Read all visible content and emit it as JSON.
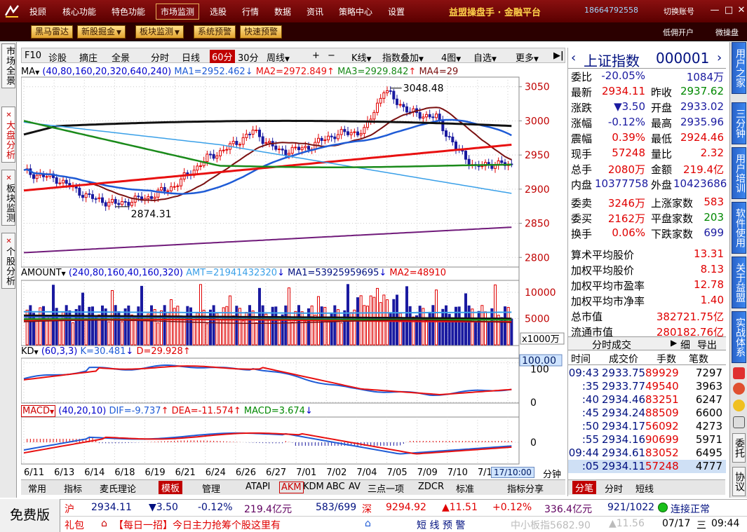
{
  "menu": {
    "items": [
      "投顾",
      "核心功能",
      "特色功能",
      "市场监测",
      "选股",
      "行情",
      "数据",
      "资讯",
      "策略中心",
      "设置"
    ],
    "active": "市场监测",
    "brand": "益盟操盘手 · 金融平台",
    "phone": "18664792558",
    "switch_account": "切换账号"
  },
  "subtoolbar": {
    "buttons": [
      "黑马雷达",
      "新股掘金",
      "板块监测",
      "系统预警",
      "快速预警"
    ],
    "open_account": "低佣开户",
    "micro_trade": "微操盘"
  },
  "left_tabs": [
    "市场全景",
    "大盘分析",
    "板块监测",
    "个股分析"
  ],
  "chart_toolbar": {
    "items": [
      "F10",
      "诊股",
      "摘庄",
      "全景",
      "分时",
      "日线",
      "60分",
      "30分",
      "周线",
      "+",
      "−",
      "K线",
      "指数叠加",
      "4图",
      "自选",
      "更多"
    ],
    "selected": "60分"
  },
  "main_indicator": {
    "name": "MA",
    "params": "(40,80,160,20,320,640,240)",
    "ma1": "MA1=2952.462",
    "ma2": "MA2=2972.849",
    "ma3": "MA3=2929.842",
    "ma4": "MA4=29",
    "high_label": "3048.48",
    "low_label": "2874.31",
    "y_ticks": [
      "3050",
      "3000",
      "2950",
      "2900",
      "2850",
      "2800"
    ]
  },
  "volume_indicator": {
    "name": "AMOUNT",
    "params": "(240,80,160,40,160,320)",
    "amt": "AMT=21941432320",
    "ma1": "MA1=53925959695",
    "ma2": "MA2=48910",
    "y_ticks": [
      "10000",
      "5000"
    ],
    "unit": "x1000万"
  },
  "kd_indicator": {
    "name": "KD",
    "params": "(60,3,3)",
    "k": "K=30.481",
    "d": "D=29.928",
    "y_ticks": [
      "100.00",
      "100",
      "0"
    ]
  },
  "macd_indicator": {
    "name": "MACD",
    "params": "(40,20,10)",
    "dif": "DIF=-9.737",
    "dea": "DEA=-11.574",
    "macd": "MACD=3.674",
    "y_ticks": [
      "0"
    ]
  },
  "x_axis": {
    "dates": [
      "6/11",
      "6/13",
      "6/14",
      "6/18",
      "6/19",
      "6/21",
      "6/24",
      "6/26",
      "6/27",
      "7/01",
      "7/02",
      "7/04",
      "7/05",
      "7/09",
      "7/10",
      "7/12",
      "7/1"
    ],
    "cursor_label": "17/10:00",
    "period": "分钟"
  },
  "bottom_tabs": {
    "items": [
      "常用",
      "指标",
      "麦氏理论",
      "模板",
      "管理",
      "ATAPI",
      "AKM",
      "KDM",
      "ABC",
      "AV",
      "三点一项",
      "ZDCR",
      "标准",
      "指标分享"
    ],
    "selected": "模板"
  },
  "quote": {
    "title": "上证指数",
    "code": "000001",
    "rows": [
      {
        "l1": "委比",
        "v1": "-20.05%",
        "l2": "",
        "v2": "1084万"
      },
      {
        "l1": "最新",
        "v1": "2934.11",
        "l2": "昨收",
        "v2": "2937.62"
      },
      {
        "l1": "涨跌",
        "v1": "▼3.50",
        "l2": "开盘",
        "v2": "2933.02"
      },
      {
        "l1": "涨幅",
        "v1": "-0.12%",
        "l2": "最高",
        "v2": "2935.96"
      },
      {
        "l1": "震幅",
        "v1": "0.39%",
        "l2": "最低",
        "v2": "2924.46"
      },
      {
        "l1": "现手",
        "v1": "57248",
        "l2": "量比",
        "v2": "2.32"
      },
      {
        "l1": "总手",
        "v1": "2080万",
        "l2": "金额",
        "v2": "219.4亿"
      },
      {
        "l1": "内盘",
        "v1": "10377758",
        "l2": "外盘",
        "v2": "10423686"
      }
    ],
    "breadth": [
      {
        "l1": "委卖",
        "v1": "3246万",
        "l2": "上涨家数",
        "v2": "583"
      },
      {
        "l1": "委买",
        "v1": "2162万",
        "l2": "平盘家数",
        "v2": "203"
      },
      {
        "l1": "换手",
        "v1": "0.06%",
        "l2": "下跌家数",
        "v2": "699"
      }
    ],
    "stats": [
      {
        "label": "算术平均股价",
        "value": "13.31"
      },
      {
        "label": "加权平均股价",
        "value": "8.13"
      },
      {
        "label": "加权平均市盈率",
        "value": "12.78"
      },
      {
        "label": "加权平均市净率",
        "value": "1.40"
      },
      {
        "label": "总市值",
        "value": "382721.75亿"
      },
      {
        "label": "流通市值",
        "value": "280182.76亿"
      }
    ],
    "ticks_title": "分时成交",
    "ticks_detail": "细",
    "ticks_export": "导出",
    "ticks_headers": [
      "时间",
      "成交价",
      "手数",
      "笔数"
    ],
    "ticks": [
      {
        "time": "09:43",
        "price": "2933.75",
        "vol": "89929",
        "count": "7297"
      },
      {
        "time": ":35",
        "price": "2933.77",
        "vol": "49540",
        "count": "3963"
      },
      {
        "time": ":40",
        "price": "2934.46",
        "vol": "83251",
        "count": "6247"
      },
      {
        "time": ":45",
        "price": "2934.24",
        "vol": "88509",
        "count": "6600"
      },
      {
        "time": ":50",
        "price": "2934.17",
        "vol": "56092",
        "count": "4273"
      },
      {
        "time": ":55",
        "price": "2934.16",
        "vol": "90699",
        "count": "5971"
      },
      {
        "time": "09:44",
        "price": "2934.61",
        "vol": "83052",
        "count": "6495"
      },
      {
        "time": ":05",
        "price": "2934.11",
        "vol": "57248",
        "count": "4777"
      }
    ],
    "bottom_tabs": [
      "分笔",
      "分时",
      "短线"
    ]
  },
  "far_right_tabs": [
    "用户之家",
    "三分钟",
    "用户培训",
    "软件使用",
    "关于益盟",
    "实战体系",
    "委托",
    "协议"
  ],
  "status": {
    "free": "免费版",
    "sh_label": "沪",
    "sh_price": "2934.11",
    "sh_chg": "▼3.50",
    "sh_pct": "-0.12%",
    "sh_amt": "219.4亿元",
    "sh_breadth": "583/699",
    "sz_label": "深",
    "sz_price": "9294.92",
    "sz_chg": "▲11.51",
    "sz_pct": "+0.12%",
    "sz_amt": "336.4亿元",
    "sz_breadth": "921/1022",
    "conn": "连接正常",
    "ticker_left": "礼包",
    "ticker_news": "【每日一招】今日主力抢筹个股这里有",
    "alert": "短 线 预 警",
    "small_index": "中小板指5682.90",
    "small_chg": "▲11.56",
    "date": "07/17",
    "weekday": "三",
    "time": "09:44"
  },
  "colors": {
    "menubar": "#7a0a0a",
    "up_red": "#e00000",
    "down_blue": "#1a1aa0",
    "ma_black": "#111111",
    "ma_blue": "#1e5bd6",
    "ma_red": "#e81010",
    "ma_green": "#1a8a1a",
    "ma_brown": "#7a1010",
    "ma_purple": "#701a7a",
    "ma_lightblue": "#3aa0e8"
  }
}
